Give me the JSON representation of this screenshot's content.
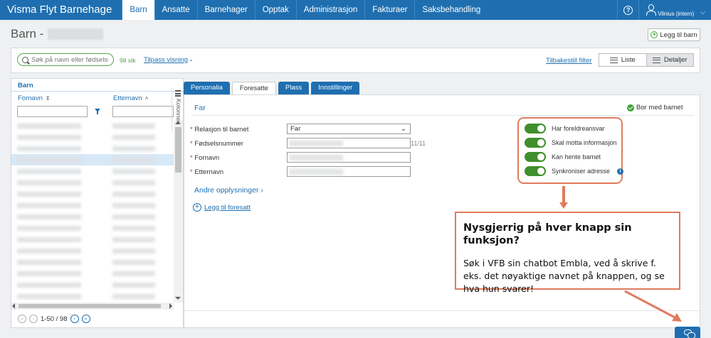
{
  "nav": {
    "brand": "Visma Flyt Barnehage",
    "items": [
      "Barn",
      "Ansatte",
      "Barnehager",
      "Opptak",
      "Administrasjon",
      "Fakturaer",
      "Saksbehandling"
    ],
    "active": "Barn",
    "help_label": "?",
    "user_label": "Vilnius (intern)"
  },
  "header": {
    "title": "Barn -",
    "add_child_label": "Legg til barn"
  },
  "toolbar": {
    "search_placeholder": "Søk på navn eller fødselsi",
    "count": "98 stk",
    "custom_view": "Tilpass visning",
    "reset_filter": "Tilbakestill filter",
    "view_list": "Liste",
    "view_details": "Detaljer",
    "active_view": "Detaljer"
  },
  "left_panel": {
    "title": "Barn",
    "col_first": "Fornavn",
    "col_last": "Etternavn",
    "pager_text": "1-50 / 98",
    "columns_label": "Kolonner"
  },
  "tabs": [
    "Personalia",
    "Foresatte",
    "Plass",
    "Innstillinger"
  ],
  "active_tab": "Foresatte",
  "guardian": {
    "title": "Far",
    "lives_with": "Bor med barnet",
    "fields": {
      "relation_label": "Relasjon til barnet",
      "relation_value": "Far",
      "ssn_label": "Fødselsnummer",
      "ssn_count": "11/11",
      "first_label": "Fornavn",
      "last_label": "Etternavn"
    },
    "more_info": "Andre opplysninger ›",
    "add_guardian": "Legg til foresatt",
    "toggles": [
      {
        "label": "Har foreldreansvar",
        "on": true
      },
      {
        "label": "Skal motta informasjon",
        "on": true
      },
      {
        "label": "Kan hente barnet",
        "on": true
      },
      {
        "label": "Synkroniser adresse",
        "on": true
      }
    ]
  },
  "callout": {
    "title": "Nysgjerrig på hver knapp sin funksjon?",
    "body": "Søk i VFB sin chatbot Embla, ved å skrive f. eks. det nøyaktige navnet på knappen, og se hva hun svarer!"
  },
  "colors": {
    "primary": "#1f6fb0",
    "toggle_on": "#3f8f2c",
    "annotation": "#e07b5c"
  }
}
